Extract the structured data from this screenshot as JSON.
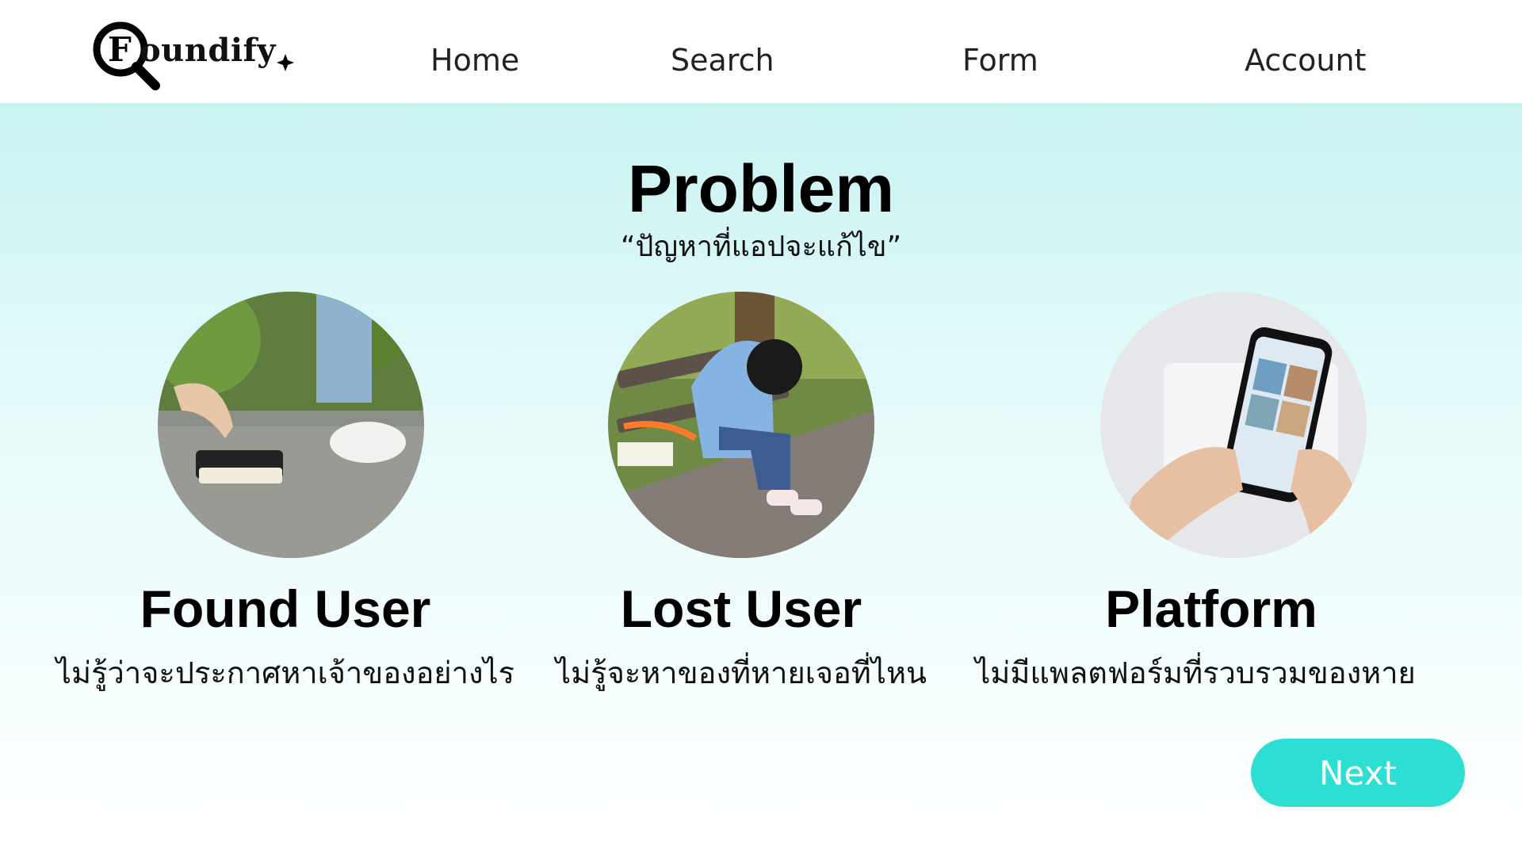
{
  "header": {
    "logo_text": "oundify",
    "logo_letter": "F",
    "nav": {
      "home": "Home",
      "search": "Search",
      "form": "Form",
      "account": "Account"
    }
  },
  "main": {
    "title": "Problem",
    "subtitle": "“ปัญหาที่แอปจะแก้ไข”",
    "cards": [
      {
        "title": "Found User",
        "desc": "ไม่รู้ว่าจะประกาศหาเจ้าของอย่างไร",
        "image": "hand-picking-up-wallet"
      },
      {
        "title": "Lost User",
        "desc": "ไม่รู้จะหาของที่หายเจอที่ไหน",
        "image": "sad-woman-on-bench"
      },
      {
        "title": "Platform",
        "desc": "ไม่มีแพลตฟอร์มที่รวบรวมของหาย",
        "image": "hands-holding-phone"
      }
    ],
    "next_label": "Next"
  },
  "colors": {
    "accent": "#2ddfd3",
    "background_top": "#c9f3f2",
    "background_bottom": "#ffffff"
  }
}
